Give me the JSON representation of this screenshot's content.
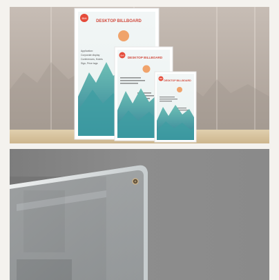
{
  "photo_top": {
    "frame_large": {
      "title": "DESKTOP BILLBOARD",
      "badge": "BMI",
      "text_lines": [
        "Application:",
        "Corporate display",
        "Conferences, Hotels",
        "Sign, Price tags"
      ]
    },
    "frame_medium": {
      "title": "DESKTOP BILLBOARD",
      "badge": "BMI"
    },
    "frame_small": {
      "title": "DESKTOP BILLBOARD",
      "badge": "BMI"
    }
  },
  "colors": {
    "wall": "#b8aea6",
    "table": "#d9c7a6",
    "mountain_teal": "#4aa7a4",
    "sun_orange": "#f0a36b",
    "acrylic_bg": "#8c8c8c"
  }
}
